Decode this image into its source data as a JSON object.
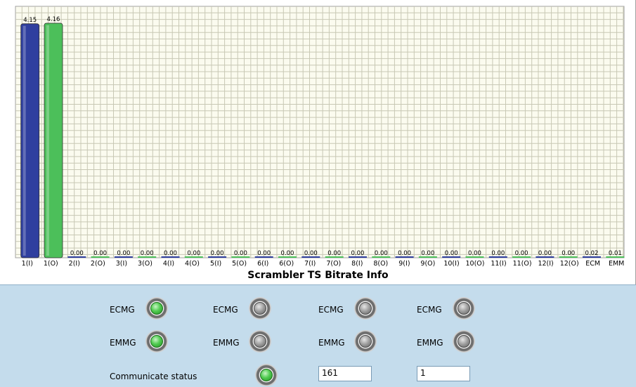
{
  "chart_data": {
    "type": "bar",
    "title": "Scrambler TS Bitrate Info",
    "categories": [
      "1(I)",
      "1(O)",
      "2(I)",
      "2(O)",
      "3(I)",
      "3(O)",
      "4(I)",
      "4(O)",
      "5(I)",
      "5(O)",
      "6(I)",
      "6(O)",
      "7(I)",
      "7(O)",
      "8(I)",
      "8(O)",
      "9(I)",
      "9(O)",
      "10(I)",
      "10(O)",
      "11(I)",
      "11(O)",
      "12(I)",
      "12(O)",
      "ECM",
      "EMM"
    ],
    "values": [
      4.15,
      4.16,
      0.0,
      0.0,
      0.0,
      0.0,
      0.0,
      0.0,
      0.0,
      0.0,
      0.0,
      0.0,
      0.0,
      0.0,
      0.0,
      0.0,
      0.0,
      0.0,
      0.0,
      0.0,
      0.0,
      0.0,
      0.0,
      0.0,
      0.02,
      0.01
    ],
    "value_labels": [
      "4.15",
      "4.16",
      "0.00",
      "0.00",
      "0.00",
      "0.00",
      "0.00",
      "0.00",
      "0.00",
      "0.00",
      "0.00",
      "0.00",
      "0.00",
      "0.00",
      "0.00",
      "0.00",
      "0.00",
      "0.00",
      "0.00",
      "0.00",
      "0.00",
      "0.00",
      "0.00",
      "0.00",
      "0.02",
      "0.01"
    ],
    "ylim": [
      0,
      4.16
    ],
    "grid": true,
    "colors": {
      "input": "#2f3f9f",
      "output": "#4cbf5a",
      "grid": "#c8c8b4",
      "background": "#fbfbef"
    }
  },
  "status": {
    "columns": [
      {
        "ecmg_label": "ECMG",
        "ecmg_on": true,
        "emmg_label": "EMMG",
        "emmg_on": true
      },
      {
        "ecmg_label": "ECMG",
        "ecmg_on": false,
        "emmg_label": "EMMG",
        "emmg_on": false
      },
      {
        "ecmg_label": "ECMG",
        "ecmg_on": false,
        "emmg_label": "EMMG",
        "emmg_on": false
      },
      {
        "ecmg_label": "ECMG",
        "ecmg_on": false,
        "emmg_label": "EMMG",
        "emmg_on": false
      }
    ],
    "communicate_label": "Communicate status",
    "communicate_on": true,
    "field1_value": "161",
    "field2_value": "1"
  }
}
